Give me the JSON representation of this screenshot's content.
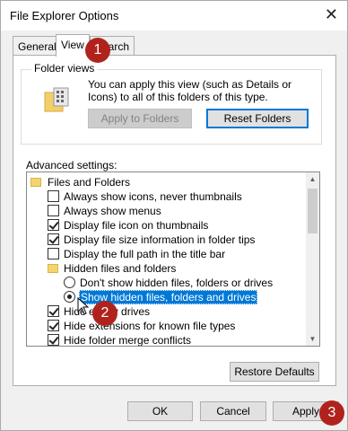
{
  "window": {
    "title": "File Explorer Options",
    "close_glyph": "✕"
  },
  "tabs": [
    {
      "label": "General"
    },
    {
      "label": "View"
    },
    {
      "label": "Search"
    }
  ],
  "folder_views": {
    "label": "Folder views",
    "description": "You can apply this view (such as Details or Icons) to all of this folders of this type.",
    "apply_button": "Apply to Folders",
    "reset_button": "Reset Folders"
  },
  "advanced": {
    "label": "Advanced settings:",
    "items": [
      {
        "text": "Files and Folders",
        "kind": "folder",
        "checked": false
      },
      {
        "text": "Always show icons, never thumbnails",
        "kind": "checkbox",
        "checked": false
      },
      {
        "text": "Always show menus",
        "kind": "checkbox",
        "checked": false
      },
      {
        "text": "Display file icon on thumbnails",
        "kind": "checkbox",
        "checked": true
      },
      {
        "text": "Display file size information in folder tips",
        "kind": "checkbox",
        "checked": true
      },
      {
        "text": "Display the full path in the title bar",
        "kind": "checkbox",
        "checked": false
      },
      {
        "text": "Hidden files and folders",
        "kind": "folder",
        "checked": false
      },
      {
        "text": "Don't show hidden files, folders or drives",
        "kind": "radio",
        "checked": false
      },
      {
        "text": "Show hidden files, folders and drives",
        "kind": "radio",
        "checked": true
      },
      {
        "text": "Hide empty drives",
        "kind": "checkbox",
        "checked": true
      },
      {
        "text": "Hide extensions for known file types",
        "kind": "checkbox",
        "checked": true
      },
      {
        "text": "Hide folder merge conflicts",
        "kind": "checkbox",
        "checked": true
      }
    ],
    "restore_button": "Restore Defaults"
  },
  "footer": {
    "ok": "OK",
    "cancel": "Cancel",
    "apply": "Apply"
  },
  "badges": [
    "1",
    "2",
    "3"
  ],
  "colors": {
    "accent": "#0078d7",
    "badge": "#b0231c"
  }
}
